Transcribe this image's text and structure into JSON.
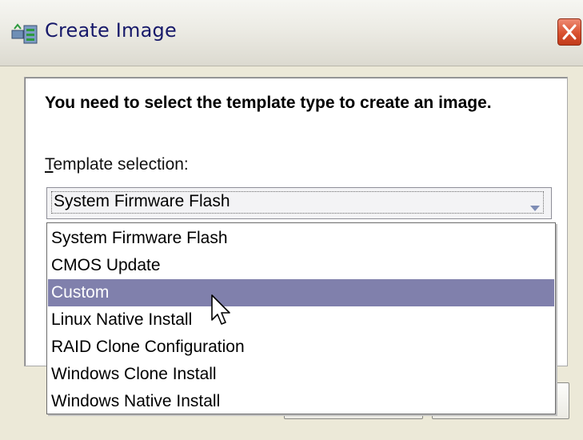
{
  "window": {
    "title": "Create Image"
  },
  "dialog": {
    "prompt": "You need to select the template type to create an image.",
    "label_mnemonic": "T",
    "label_rest": "emplate selection:",
    "selected_value": "System Firmware Flash"
  },
  "dropdown": {
    "options": [
      "System Firmware Flash",
      "CMOS Update",
      "Custom",
      "Linux Native Install",
      "RAID Clone Configuration",
      "Windows Clone Install",
      "Windows Native Install"
    ],
    "highlighted_index": 2
  },
  "colors": {
    "highlight": "#8080ac",
    "title_text": "#17196a",
    "close_button": "#d9512f"
  },
  "icons": {
    "app": "image-builder-icon",
    "close": "close-icon",
    "dropdown": "chevron-down-icon",
    "pointer": "mouse-pointer-icon"
  }
}
